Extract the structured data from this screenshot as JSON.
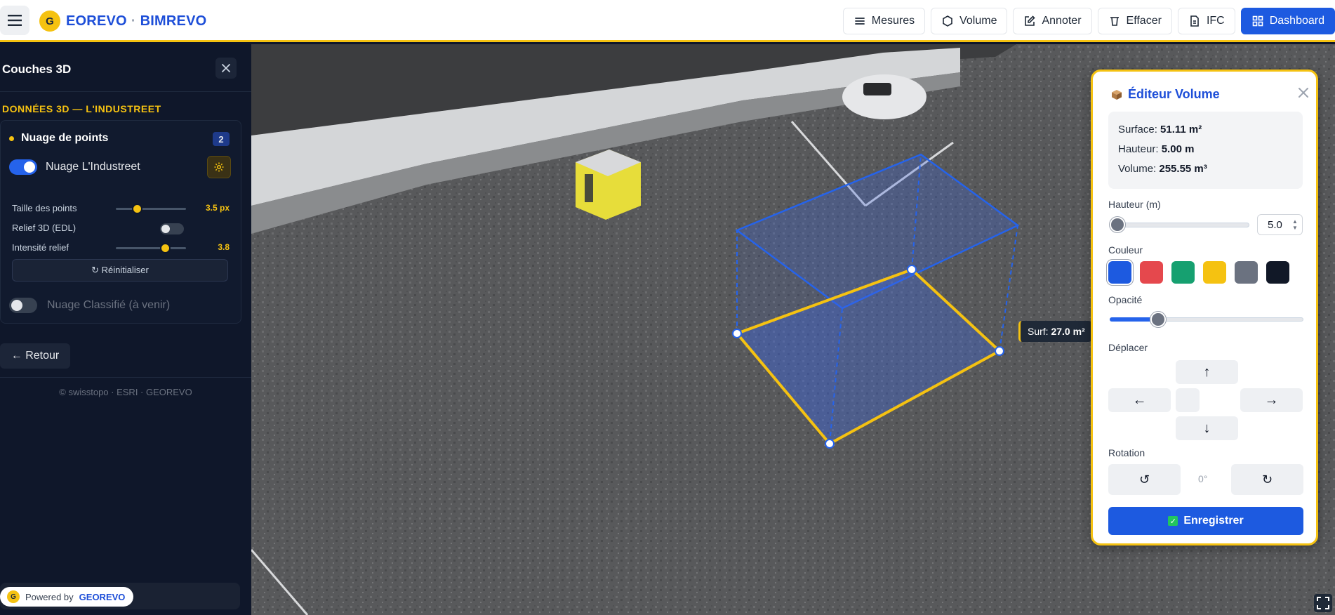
{
  "header": {
    "logo_letter": "G",
    "brand_left": "EOREVO",
    "brand_sep": "·",
    "brand_right": "BIMREVO",
    "tools": [
      {
        "label": "Mesures",
        "icon": "list-icon"
      },
      {
        "label": "Volume",
        "icon": "hexagon-icon"
      },
      {
        "label": "Annoter",
        "icon": "edit-icon"
      },
      {
        "label": "Effacer",
        "icon": "eraser-icon"
      },
      {
        "label": "IFC",
        "icon": "file-icon"
      },
      {
        "label": "Dashboard",
        "icon": "grid-icon"
      }
    ]
  },
  "sidebar": {
    "title": "Couches 3D",
    "section": "DONNÉES 3D — L'INDUSTREET",
    "layer_group": {
      "title": "Nuage de points",
      "count": "2"
    },
    "layer_main": {
      "label": "Nuage L'Industreet",
      "enabled": true
    },
    "params": {
      "point_size_label": "Taille des points",
      "point_size_value": "3.5 px",
      "point_size_fraction": 0.3,
      "relief_label": "Relief 3D (EDL)",
      "relief_enabled": false,
      "intensity_label": "Intensité relief",
      "intensity_value": "3.8",
      "intensity_fraction": 0.7
    },
    "reset_label": "↻ Réinitialiser",
    "layer_secondary": {
      "label": "Nuage Classifié (à venir)",
      "enabled": false
    },
    "back_label": "← Retour",
    "attribution": "© swisstopo · ESRI · GEOREVO",
    "powered_by": {
      "logo_letter": "G",
      "text": "Powered by",
      "brand": "GEOREVO"
    }
  },
  "scene": {
    "surface_tooltip_prefix": "Surf:",
    "surface_tooltip_value": "27.0 m²"
  },
  "editor": {
    "title": "Éditeur Volume",
    "stats": {
      "surface_label": "Surface:",
      "surface_value": "51.11 m²",
      "height_label": "Hauteur:",
      "height_value": "5.00 m",
      "volume_label": "Volume:",
      "volume_value": "255.55 m³"
    },
    "height_label": "Hauteur (m)",
    "height_value": "5.0",
    "color_label": "Couleur",
    "colors": [
      "#1d5ae0",
      "#e5484d",
      "#16a070",
      "#f5c211",
      "#6b7280",
      "#111827"
    ],
    "selected_color": "#1d5ae0",
    "opacity_label": "Opacité",
    "opacity_fraction": 0.25,
    "move_label": "Déplacer",
    "move": {
      "up": "↑",
      "left": "←",
      "right": "→",
      "down": "↓"
    },
    "rotation_label": "Rotation",
    "rotation_ccw": "↺",
    "rotation_value": "0°",
    "rotation_cw": "↻",
    "save_label": "Enregistrer"
  }
}
